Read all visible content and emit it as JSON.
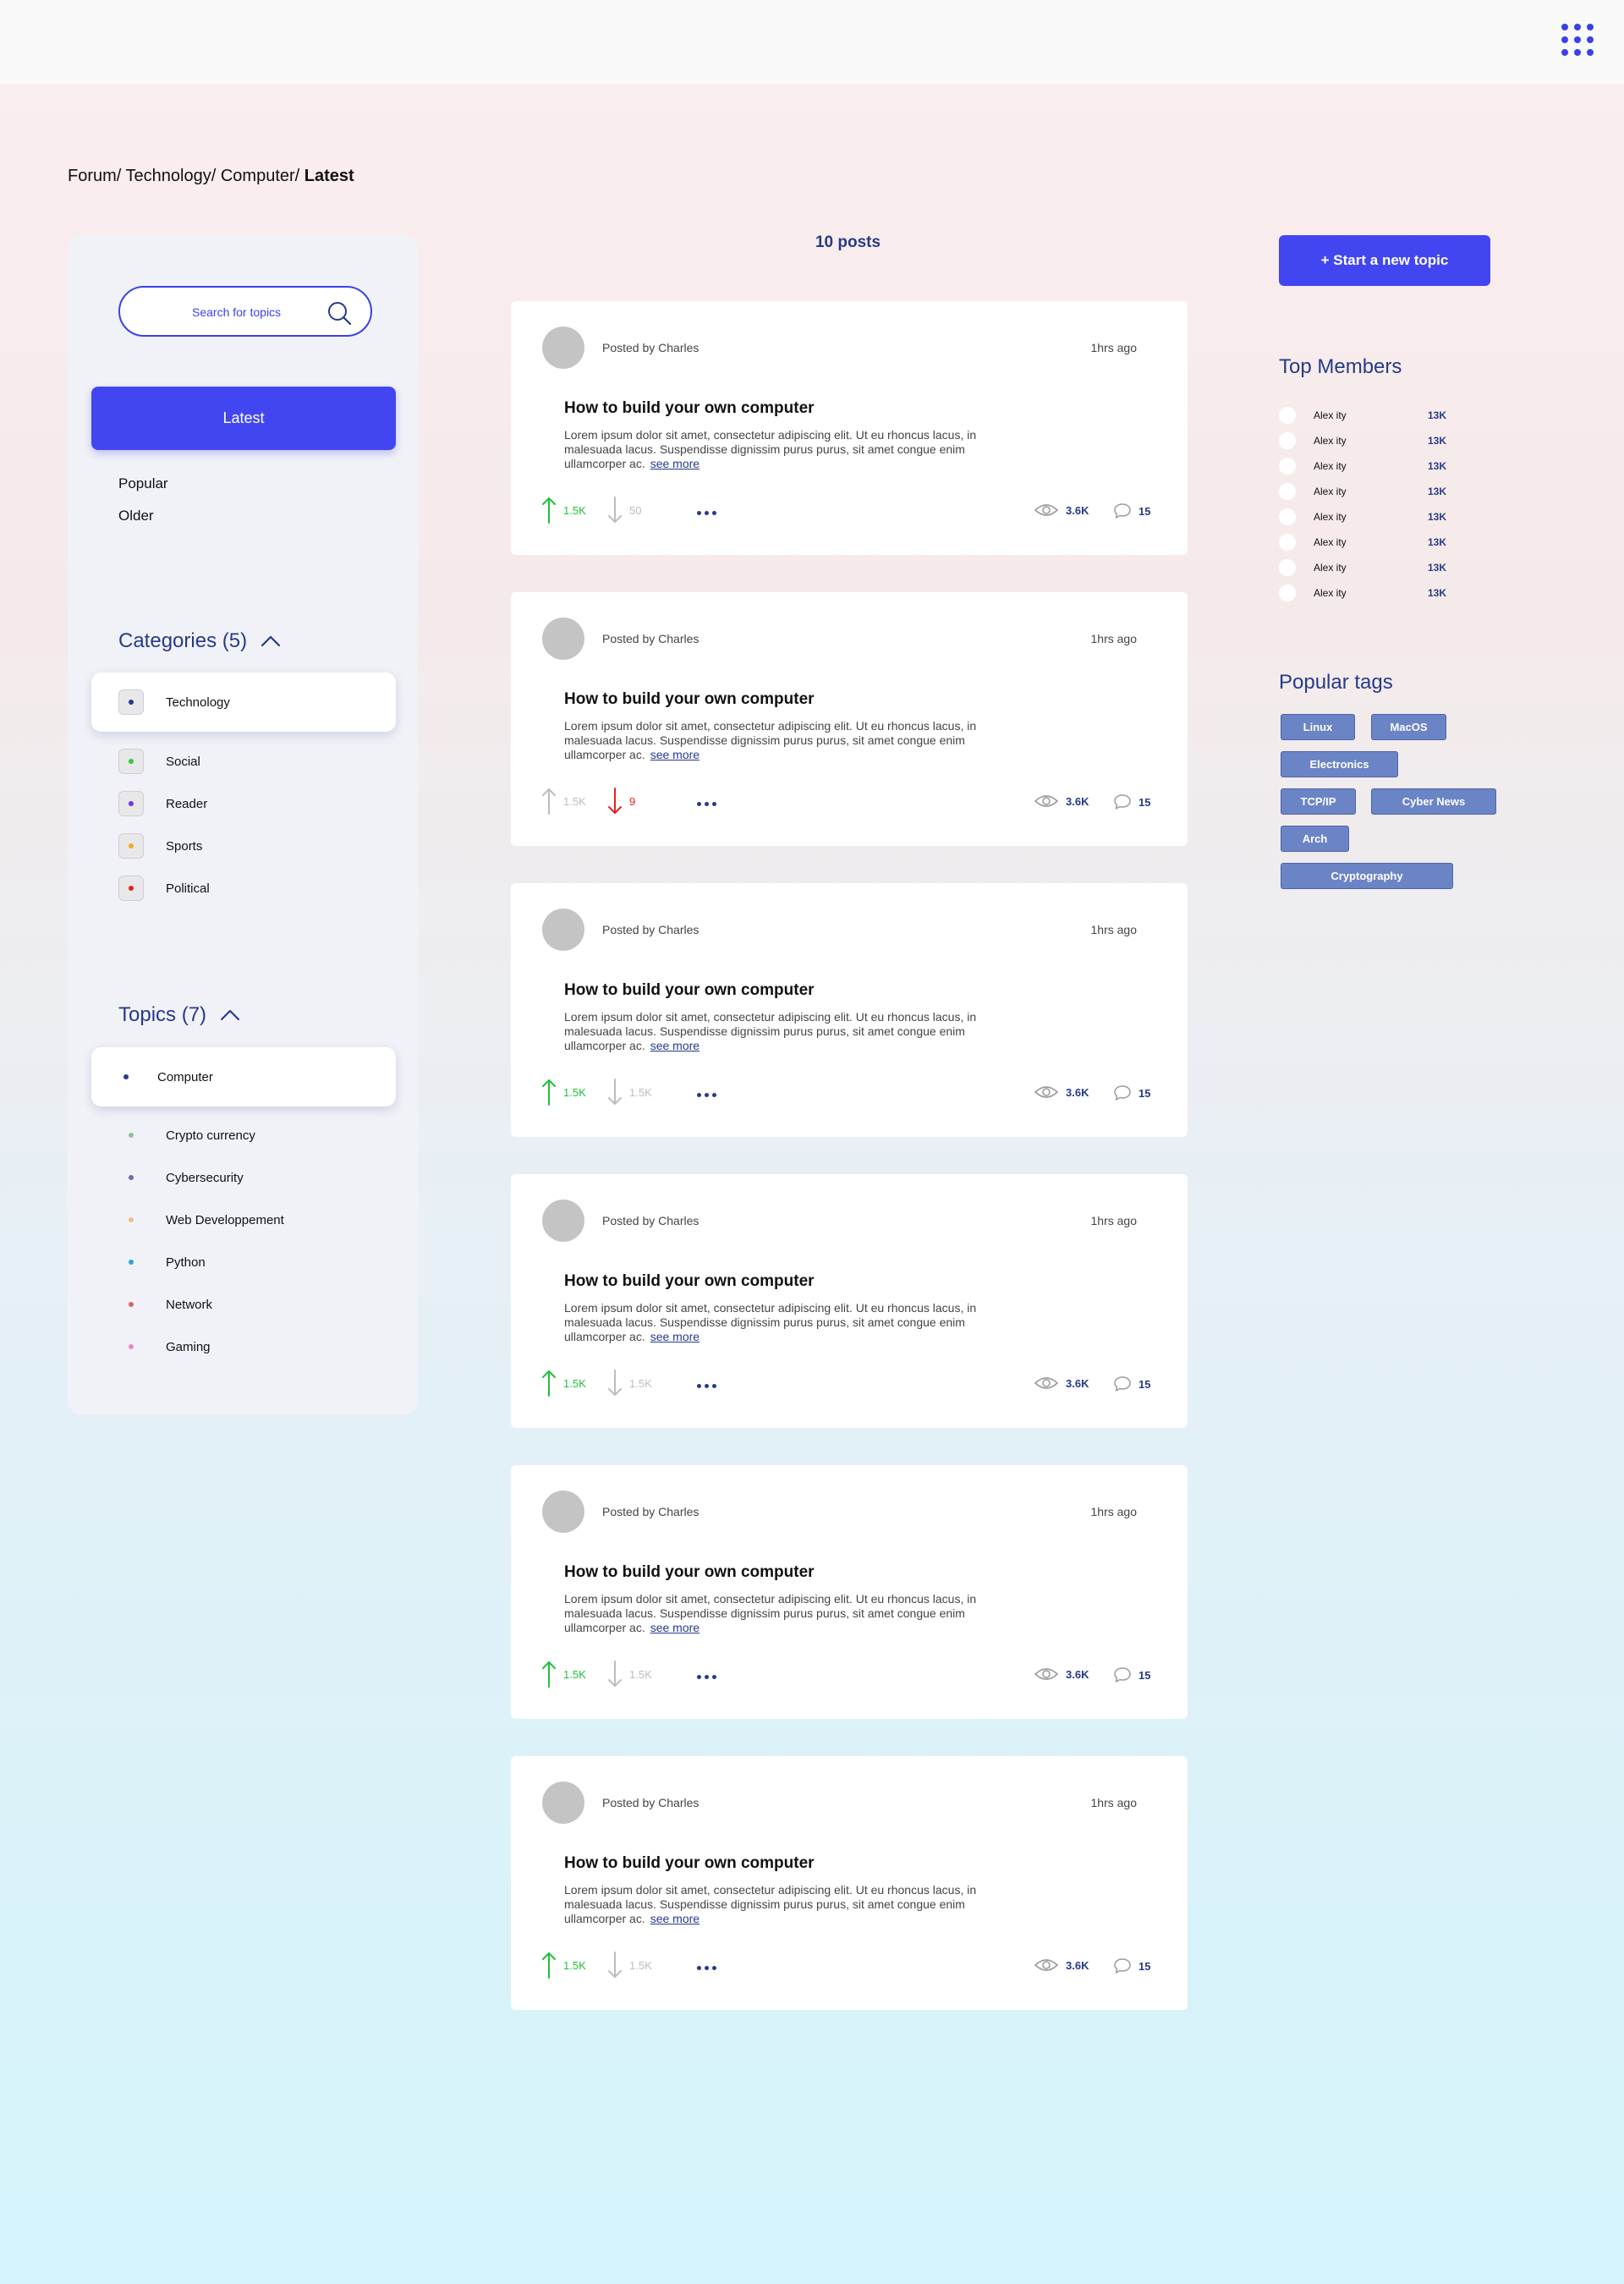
{
  "header": {
    "apps_icon": "grid-dots-icon"
  },
  "breadcrumb": {
    "parts": [
      "Forum/ ",
      "Technology/ ",
      "Computer/ "
    ],
    "current": "Latest"
  },
  "sidebar": {
    "search_placeholder": "Search for topics",
    "sort": {
      "active": "Latest",
      "others": [
        "Popular",
        "Older"
      ]
    },
    "categories_title": "Categories (5)",
    "categories": [
      {
        "label": "Technology",
        "color": "#263a8a",
        "active": true
      },
      {
        "label": "Social",
        "color": "#2ecc40"
      },
      {
        "label": "Reader",
        "color": "#7b2ff0"
      },
      {
        "label": "Sports",
        "color": "#f5a623"
      },
      {
        "label": "Political",
        "color": "#e8201a"
      }
    ],
    "topics_title": "Topics (7)",
    "topics": [
      {
        "label": "Computer",
        "color": "#263a8a",
        "active": true
      },
      {
        "label": "Crypto currency",
        "color": "#8fbf9a"
      },
      {
        "label": "Cybersecurity",
        "color": "#6b6bb0"
      },
      {
        "label": "Web Developpement",
        "color": "#f0c080"
      },
      {
        "label": "Python",
        "color": "#2fa3d8"
      },
      {
        "label": "Network",
        "color": "#e06060"
      },
      {
        "label": "Gaming",
        "color": "#e88ac0"
      }
    ]
  },
  "main": {
    "posts_count": "10 posts",
    "posts": [
      {
        "author": "Posted by Charles",
        "time": "1hrs ago",
        "title": "How to build your own computer",
        "body": "Lorem ipsum dolor sit amet, consectetur adipiscing elit. Ut eu rhoncus lacus, in malesuada lacus. Suspendisse dignissim purus purus, sit amet congue enim ullamcorper ac.",
        "see_more": "see more",
        "upvotes": "1.5K",
        "downvotes": "50",
        "vote": "up",
        "views": "3.6K",
        "comments": "15"
      },
      {
        "author": "Posted by Charles",
        "time": "1hrs ago",
        "title": "How to build your own computer",
        "body": "Lorem ipsum dolor sit amet, consectetur adipiscing elit. Ut eu rhoncus lacus, in malesuada lacus. Suspendisse dignissim purus purus, sit amet congue enim ullamcorper ac.",
        "see_more": "see more",
        "upvotes": "1.5K",
        "downvotes": "9",
        "vote": "down",
        "views": "3.6K",
        "comments": "15"
      },
      {
        "author": "Posted by Charles",
        "time": "1hrs ago",
        "title": "How to build your own computer",
        "body": "Lorem ipsum dolor sit amet, consectetur adipiscing elit. Ut eu rhoncus lacus, in malesuada lacus. Suspendisse dignissim purus purus, sit amet congue enim ullamcorper ac.",
        "see_more": "see more",
        "upvotes": "1.5K",
        "downvotes": "1.5K",
        "vote": "up",
        "views": "3.6K",
        "comments": "15"
      },
      {
        "author": "Posted by Charles",
        "time": "1hrs ago",
        "title": "How to build your own computer",
        "body": "Lorem ipsum dolor sit amet, consectetur adipiscing elit. Ut eu rhoncus lacus, in malesuada lacus. Suspendisse dignissim purus purus, sit amet congue enim ullamcorper ac.",
        "see_more": "see more",
        "upvotes": "1.5K",
        "downvotes": "1.5K",
        "vote": "up",
        "views": "3.6K",
        "comments": "15"
      },
      {
        "author": "Posted by Charles",
        "time": "1hrs ago",
        "title": "How to build your own computer",
        "body": "Lorem ipsum dolor sit amet, consectetur adipiscing elit. Ut eu rhoncus lacus, in malesuada lacus. Suspendisse dignissim purus purus, sit amet congue enim ullamcorper ac.",
        "see_more": "see more",
        "upvotes": "1.5K",
        "downvotes": "1.5K",
        "vote": "up",
        "views": "3.6K",
        "comments": "15"
      },
      {
        "author": "Posted by Charles",
        "time": "1hrs ago",
        "title": "How to build your own computer",
        "body": "Lorem ipsum dolor sit amet, consectetur adipiscing elit. Ut eu rhoncus lacus, in malesuada lacus. Suspendisse dignissim purus purus, sit amet congue enim ullamcorper ac.",
        "see_more": "see more",
        "upvotes": "1.5K",
        "downvotes": "1.5K",
        "vote": "up",
        "views": "3.6K",
        "comments": "15"
      }
    ]
  },
  "right": {
    "new_topic_label": "+ Start a new topic",
    "members_title": "Top Members",
    "members": [
      {
        "name": "Alex ity",
        "score": "13K"
      },
      {
        "name": "Alex ity",
        "score": "13K"
      },
      {
        "name": "Alex ity",
        "score": "13K"
      },
      {
        "name": "Alex ity",
        "score": "13K"
      },
      {
        "name": "Alex ity",
        "score": "13K"
      },
      {
        "name": "Alex ity",
        "score": "13K"
      },
      {
        "name": "Alex ity",
        "score": "13K"
      },
      {
        "name": "Alex ity",
        "score": "13K"
      }
    ],
    "tags_title": "Popular tags",
    "tags": [
      "Linux",
      "MacOS",
      "Electronics",
      "TCP/IP",
      "Cyber News",
      "Arch",
      "Cryptography"
    ]
  },
  "colors": {
    "accent": "#4246f0",
    "navy": "#263a8a",
    "upvote": "#22c03a",
    "downvote": "#e8201a",
    "muted": "#bdbdbd",
    "tag": "#6b84c6"
  }
}
